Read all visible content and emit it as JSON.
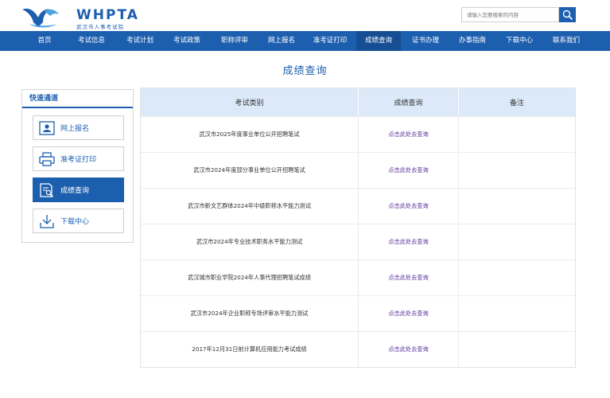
{
  "header": {
    "logo_text": "WHPTA",
    "logo_sub": "武汉市人事考试院",
    "search_placeholder": "请输入您要搜索的内容",
    "search_button_icon": "search-icon"
  },
  "nav": {
    "items": [
      {
        "label": "首页"
      },
      {
        "label": "考试信息"
      },
      {
        "label": "考试计划"
      },
      {
        "label": "考试政策"
      },
      {
        "label": "职称评审"
      },
      {
        "label": "网上报名"
      },
      {
        "label": "准考证打印"
      },
      {
        "label": "成绩查询"
      },
      {
        "label": "证书办理"
      },
      {
        "label": "办事指南"
      },
      {
        "label": "下载中心"
      },
      {
        "label": "联系我们"
      }
    ],
    "active_index": 7
  },
  "page_title": "成绩查询",
  "sidebar": {
    "title": "快速通道",
    "items": [
      {
        "label": "网上报名",
        "icon": "id-card-icon"
      },
      {
        "label": "准考证打印",
        "icon": "printer-icon"
      },
      {
        "label": "成绩查询",
        "icon": "document-search-icon"
      },
      {
        "label": "下载中心",
        "icon": "download-icon"
      }
    ],
    "active_index": 2
  },
  "table": {
    "headers": [
      "考试类别",
      "成绩查询",
      "备注"
    ],
    "rows": [
      {
        "category": "武汉市2025年度事业单位公开招聘笔试",
        "link": "点击此处去查询",
        "note": ""
      },
      {
        "category": "武汉市2024年度部分事业单位公开招聘笔试",
        "link": "点击此处去查询",
        "note": ""
      },
      {
        "category": "武汉市新文艺群体2024年中级职称水平能力测试",
        "link": "点击此处去查询",
        "note": ""
      },
      {
        "category": "武汉市2024年专业技术职务水平能力测试",
        "link": "点击此处去查询",
        "note": ""
      },
      {
        "category": "武汉城市职业学院2024年人事代理招聘笔试成绩",
        "link": "点击此处去查询",
        "note": ""
      },
      {
        "category": "武汉市2024年企业职称专场评审水平能力测试",
        "link": "点击此处去查询",
        "note": ""
      },
      {
        "category": "2017年12月31日前计算机应用能力考试成绩",
        "link": "点击此处去查询",
        "note": ""
      }
    ]
  },
  "colors": {
    "brand_blue": "#1d5faf",
    "nav_active": "#164e93",
    "table_header_bg": "#dce9f8",
    "link_purple": "#5a2fa0"
  }
}
